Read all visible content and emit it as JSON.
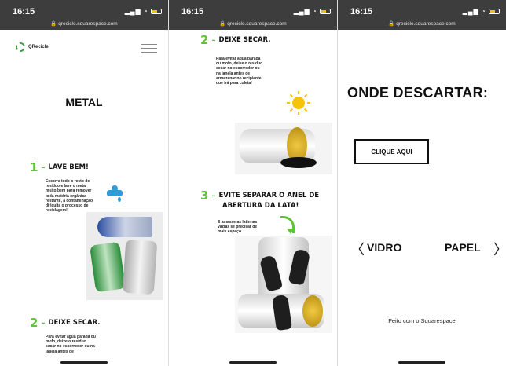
{
  "status": {
    "time": "16:15",
    "url": "qrecicle.squarespace.com",
    "signal": "▂▄▆",
    "wifi": "◔"
  },
  "panel1": {
    "logo_text": "QRecicle",
    "heading": "METAL",
    "step1": {
      "number": "1",
      "title": "LAVE BEM!",
      "text": "Escorra todo o resto de resíduo e lave o metal muito bem para remover toda matéria orgânica restante, a contaminação dificulta o processo de reciclagem!"
    },
    "step2": {
      "number": "2",
      "title": "DEIXE SECAR.",
      "text": "Para evitar água parada ou mofo, deixe o resíduo secar no escorredor ou na janela antes de"
    }
  },
  "panel2": {
    "step2": {
      "number": "2",
      "title": "DEIXE SECAR.",
      "text": "Para evitar água parada ou mofo, deixe o resíduo secar no escorredor ou na janela antes de armazenar no recipiente que irá para coleta!"
    },
    "step3": {
      "number": "3",
      "title_line1": "EVITE SEPARAR O ANEL DE",
      "title_line2": "ABERTURA DA LATA!",
      "text": "E amasse as latinhas vazias se precisar de mais espaço."
    }
  },
  "panel3": {
    "heading": "ONDE DESCARTAR:",
    "button": "CLIQUE AQUI",
    "prev": "〈",
    "next": "〉",
    "item_left": "VIDRO",
    "item_right": "PAPEL",
    "footer_prefix": "Feito com o ",
    "footer_link": "Squarespace"
  },
  "colors": {
    "accent_green": "#62c23b",
    "status_bar": "#3d3d3d",
    "water_blue": "#2e9ad6",
    "sun_yellow": "#f7c30a"
  }
}
